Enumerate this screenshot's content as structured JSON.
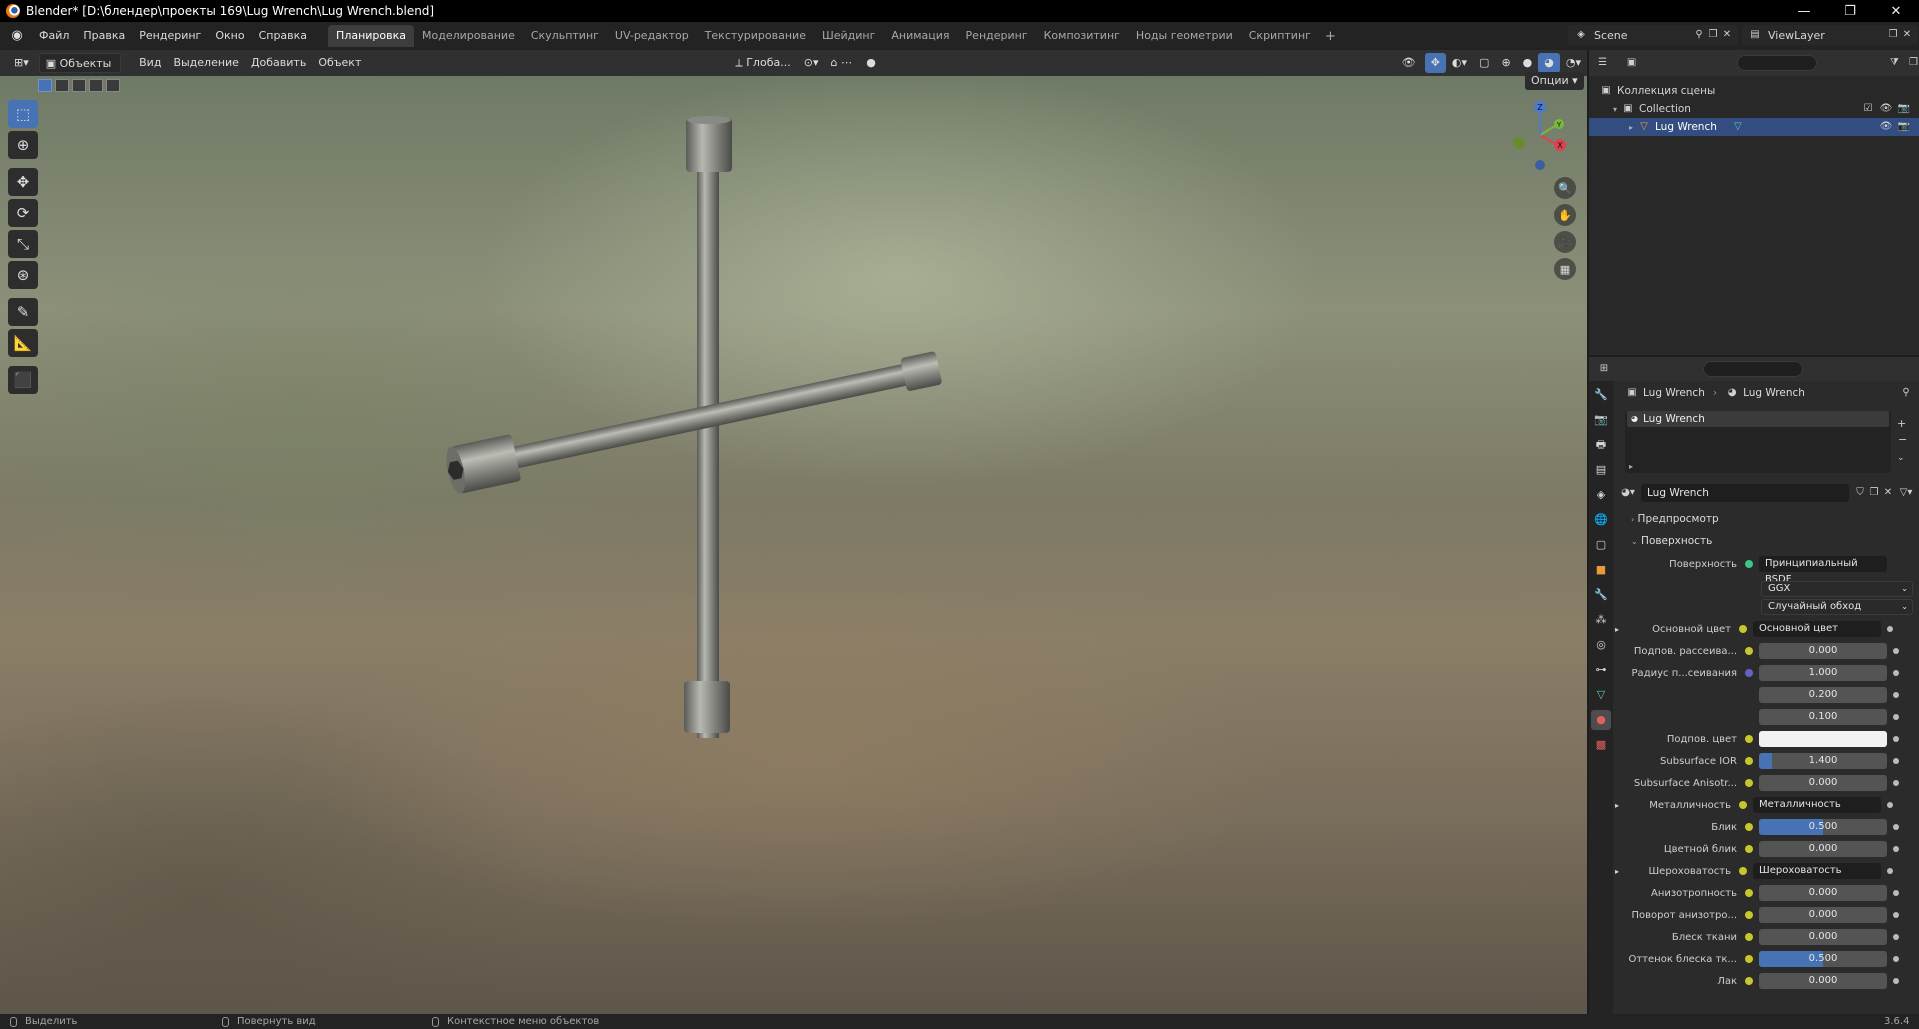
{
  "window": {
    "title": "Blender* [D:\\блендер\\проекты 169\\Lug Wrench\\Lug Wrench.blend]",
    "minimize": "—",
    "maximize": "❐",
    "close": "✕"
  },
  "menu": [
    "Файл",
    "Правка",
    "Рендеринг",
    "Окно",
    "Справка"
  ],
  "workspaces": [
    "Планировка",
    "Моделирование",
    "Скульптинг",
    "UV-редактор",
    "Текстурирование",
    "Шейдинг",
    "Анимация",
    "Рендеринг",
    "Композитинг",
    "Ноды геометрии",
    "Скриптинг"
  ],
  "active_workspace": "Планировка",
  "scene": "Scene",
  "view_layer": "ViewLayer",
  "viewport_header": {
    "mode": "Объекты",
    "menus": [
      "Вид",
      "Выделение",
      "Добавить",
      "Объект"
    ],
    "orientation": "Глоба...",
    "options": "Опции"
  },
  "outliner": {
    "scene_collection": "Коллекция сцены",
    "collection": "Collection",
    "object": "Lug Wrench"
  },
  "properties": {
    "breadcrumb_object": "Lug Wrench",
    "breadcrumb_material": "Lug Wrench",
    "slot": "Lug Wrench",
    "material_name": "Lug Wrench",
    "panel_preview": "Предпросмотр",
    "panel_surface": "Поверхность",
    "surface_label": "Поверхность",
    "surface_value": "Принципиальный BSDF",
    "distribution": "GGX",
    "subsurface_method": "Случайный обход",
    "rows": [
      {
        "label": "Основной цвет",
        "type": "link",
        "value": "Основной цвет",
        "expand": true
      },
      {
        "label": "Подпов. рассеива...",
        "type": "num",
        "value": "0.000",
        "fill": 0
      },
      {
        "label": "Радиус п...сеивания",
        "type": "num",
        "value": "1.000",
        "fill": 0,
        "dot": "purple"
      },
      {
        "label": "",
        "type": "num",
        "value": "0.200",
        "fill": 0
      },
      {
        "label": "",
        "type": "num",
        "value": "0.100",
        "fill": 0
      },
      {
        "label": "Подпов. цвет",
        "type": "color",
        "value": ""
      },
      {
        "label": "Subsurface IOR",
        "type": "num",
        "value": "1.400",
        "fill": 0.1
      },
      {
        "label": "Subsurface Anisotr...",
        "type": "num",
        "value": "0.000",
        "fill": 0
      },
      {
        "label": "Металличность",
        "type": "link",
        "value": "Металличность",
        "expand": true
      },
      {
        "label": "Блик",
        "type": "num",
        "value": "0.500",
        "fill": 0.5
      },
      {
        "label": "Цветной блик",
        "type": "num",
        "value": "0.000",
        "fill": 0
      },
      {
        "label": "Шероховатость",
        "type": "link",
        "value": "Шероховатость",
        "expand": true
      },
      {
        "label": "Анизотропность",
        "type": "num",
        "value": "0.000",
        "fill": 0
      },
      {
        "label": "Поворот анизотро...",
        "type": "num",
        "value": "0.000",
        "fill": 0
      },
      {
        "label": "Блеск ткани",
        "type": "num",
        "value": "0.000",
        "fill": 0
      },
      {
        "label": "Оттенок блеска тк...",
        "type": "num",
        "value": "0.500",
        "fill": 0.5
      },
      {
        "label": "Лак",
        "type": "num",
        "value": "0.000",
        "fill": 0
      }
    ]
  },
  "statusbar": {
    "select": "Выделить",
    "rotate": "Повернуть вид",
    "context": "Контекстное меню объектов",
    "version": "3.6.4"
  },
  "colors": {
    "accent": "#4772b3",
    "selected_row": "#334d80",
    "socket_yellow": "#c7c729",
    "socket_purple": "#6363c7"
  },
  "gizmo": {
    "x": "X",
    "y": "Y",
    "z": "Z"
  }
}
